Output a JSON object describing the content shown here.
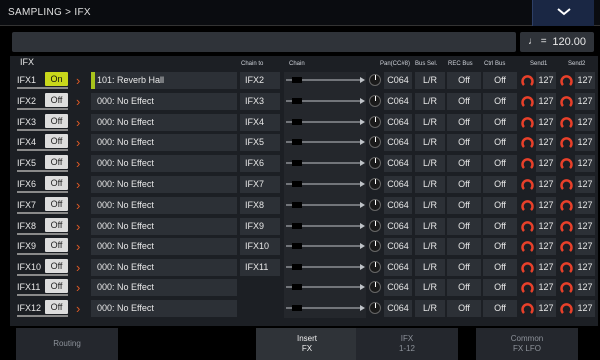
{
  "header": {
    "breadcrumb": "SAMPLING > IFX",
    "menu_icon": "chevron-down-icon"
  },
  "tempo": {
    "note_symbol": "♩",
    "equals": "=",
    "value": "120.00"
  },
  "columns": {
    "ifx": "IFX",
    "chain_to": "Chain to",
    "chain": "Chain",
    "pan": "Pan(CC#8)",
    "bus_sel": "Bus Sel.",
    "rec_bus": "REC Bus",
    "ctrl_bus": "Ctrl Bus",
    "send1": "Send1",
    "send2": "Send2"
  },
  "rows": [
    {
      "label": "IFX1",
      "state": "On",
      "effect": "101: Reverb Hall",
      "chain_to": "IFX2",
      "pan": "C064",
      "bus": "L/R",
      "rec": "Off",
      "ctrl": "Off",
      "send1": "127",
      "send2": "127"
    },
    {
      "label": "IFX2",
      "state": "Off",
      "effect": "000: No Effect",
      "chain_to": "IFX3",
      "pan": "C064",
      "bus": "L/R",
      "rec": "Off",
      "ctrl": "Off",
      "send1": "127",
      "send2": "127"
    },
    {
      "label": "IFX3",
      "state": "Off",
      "effect": "000: No Effect",
      "chain_to": "IFX4",
      "pan": "C064",
      "bus": "L/R",
      "rec": "Off",
      "ctrl": "Off",
      "send1": "127",
      "send2": "127"
    },
    {
      "label": "IFX4",
      "state": "Off",
      "effect": "000: No Effect",
      "chain_to": "IFX5",
      "pan": "C064",
      "bus": "L/R",
      "rec": "Off",
      "ctrl": "Off",
      "send1": "127",
      "send2": "127"
    },
    {
      "label": "IFX5",
      "state": "Off",
      "effect": "000: No Effect",
      "chain_to": "IFX6",
      "pan": "C064",
      "bus": "L/R",
      "rec": "Off",
      "ctrl": "Off",
      "send1": "127",
      "send2": "127"
    },
    {
      "label": "IFX6",
      "state": "Off",
      "effect": "000: No Effect",
      "chain_to": "IFX7",
      "pan": "C064",
      "bus": "L/R",
      "rec": "Off",
      "ctrl": "Off",
      "send1": "127",
      "send2": "127"
    },
    {
      "label": "IFX7",
      "state": "Off",
      "effect": "000: No Effect",
      "chain_to": "IFX8",
      "pan": "C064",
      "bus": "L/R",
      "rec": "Off",
      "ctrl": "Off",
      "send1": "127",
      "send2": "127"
    },
    {
      "label": "IFX8",
      "state": "Off",
      "effect": "000: No Effect",
      "chain_to": "IFX9",
      "pan": "C064",
      "bus": "L/R",
      "rec": "Off",
      "ctrl": "Off",
      "send1": "127",
      "send2": "127"
    },
    {
      "label": "IFX9",
      "state": "Off",
      "effect": "000: No Effect",
      "chain_to": "IFX10",
      "pan": "C064",
      "bus": "L/R",
      "rec": "Off",
      "ctrl": "Off",
      "send1": "127",
      "send2": "127"
    },
    {
      "label": "IFX10",
      "state": "Off",
      "effect": "000: No Effect",
      "chain_to": "IFX11",
      "pan": "C064",
      "bus": "L/R",
      "rec": "Off",
      "ctrl": "Off",
      "send1": "127",
      "send2": "127"
    },
    {
      "label": "IFX11",
      "state": "Off",
      "effect": "000: No Effect",
      "chain_to": "",
      "pan": "C064",
      "bus": "L/R",
      "rec": "Off",
      "ctrl": "Off",
      "send1": "127",
      "send2": "127"
    },
    {
      "label": "IFX12",
      "state": "Off",
      "effect": "000: No Effect",
      "chain_to": "",
      "pan": "C064",
      "bus": "L/R",
      "rec": "Off",
      "ctrl": "Off",
      "send1": "127",
      "send2": "127"
    }
  ],
  "tabs": [
    {
      "line1": "Routing",
      "line2": "",
      "active": false
    },
    {
      "line1": "Insert",
      "line2": "FX",
      "active": true
    },
    {
      "line1": "IFX",
      "line2": "1-12",
      "active": false
    },
    {
      "line1": "Common",
      "line2": "FX LFO",
      "active": false
    }
  ],
  "colors": {
    "toggle_on": "#c9d81b",
    "arrow": "#e05a24",
    "send_knob": "#e8402a",
    "selected_mark": "#a9c41c"
  }
}
